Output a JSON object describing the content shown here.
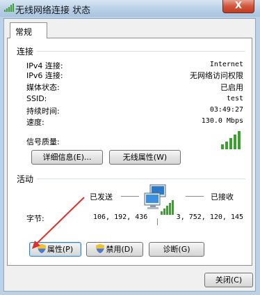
{
  "window": {
    "title": "无线网络连接 状态",
    "close_glyph": "X"
  },
  "tabs": [
    {
      "label": "常规"
    }
  ],
  "connection": {
    "heading": "连接",
    "rows": [
      {
        "label": "IPv4 连接:",
        "value": "Internet"
      },
      {
        "label": "IPv6 连接:",
        "value": "无网络访问权限"
      },
      {
        "label": "媒体状态:",
        "value": "已启用"
      },
      {
        "label": "SSID:",
        "value": "test"
      },
      {
        "label": "持续时间:",
        "value": "03:49:27"
      },
      {
        "label": "速度:",
        "value": "130.0 Mbps"
      }
    ],
    "signal_label": "信号质量:",
    "signal_bars": 5,
    "signal_level": 5,
    "details_button": "详细信息(E)...",
    "wireless_props_button": "无线属性(W)"
  },
  "activity": {
    "heading": "活动",
    "sent_label": "已发送",
    "received_label": "已接收",
    "bytes_label": "字节:",
    "bytes_sent": "106, 192, 436",
    "bytes_received": "3, 752, 120, 145",
    "properties_button": "属性(P)",
    "disable_button": "禁用(D)",
    "diagnose_button": "诊断(G)"
  },
  "footer": {
    "close_button": "关闭(C)"
  },
  "colors": {
    "signal_green": "#3aa12f",
    "annotation_arrow": "#e0302a"
  }
}
